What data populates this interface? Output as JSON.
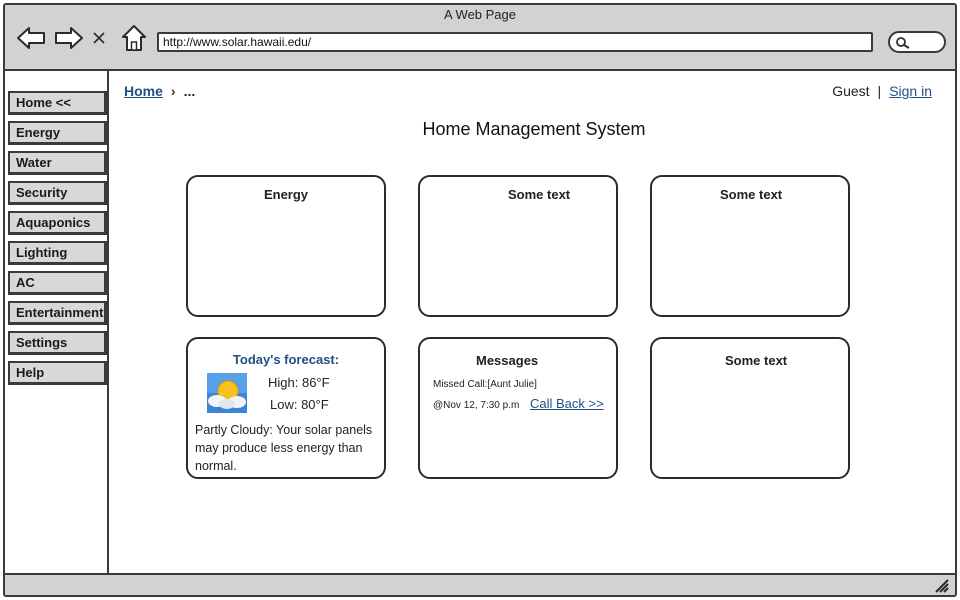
{
  "window": {
    "title": "A Web Page"
  },
  "browser": {
    "url": "http://www.solar.hawaii.edu/",
    "icons": [
      "back-arrow-icon",
      "forward-arrow-icon",
      "close-x-icon",
      "home-icon",
      "search-icon"
    ]
  },
  "sidebar": {
    "items": [
      {
        "label": "Home <<"
      },
      {
        "label": "Energy"
      },
      {
        "label": "Water"
      },
      {
        "label": "Security"
      },
      {
        "label": "Aquaponics"
      },
      {
        "label": "Lighting"
      },
      {
        "label": "AC"
      },
      {
        "label": "Entertainment"
      },
      {
        "label": "Settings"
      },
      {
        "label": "Help"
      }
    ]
  },
  "breadcrumb": {
    "home": "Home",
    "separator": "›",
    "current": "..."
  },
  "user": {
    "name": "Guest",
    "divider": "|",
    "signin": "Sign in"
  },
  "page": {
    "title": "Home Management System"
  },
  "cards": {
    "energy": {
      "title": "Energy"
    },
    "top_middle": {
      "title": "Some text"
    },
    "top_right": {
      "title": "Some text"
    },
    "forecast": {
      "title": "Today's forecast:",
      "high": "High: 86°F",
      "low": "Low: 80°F",
      "description": "Partly Cloudy: Your solar panels may produce less energy than normal.",
      "icon": "partly-cloudy-icon"
    },
    "messages": {
      "title": "Messages",
      "missed_call": "Missed Call:[Aunt Julie]",
      "timestamp": "@Nov 12, 7:30 p.m",
      "callback": "Call Back >>"
    },
    "bottom_right": {
      "title": "Some text"
    }
  },
  "colors": {
    "link": "#1f4f86",
    "chrome": "#d2d2d2",
    "button": "#d8d8d8",
    "border": "#3a3a3a"
  }
}
